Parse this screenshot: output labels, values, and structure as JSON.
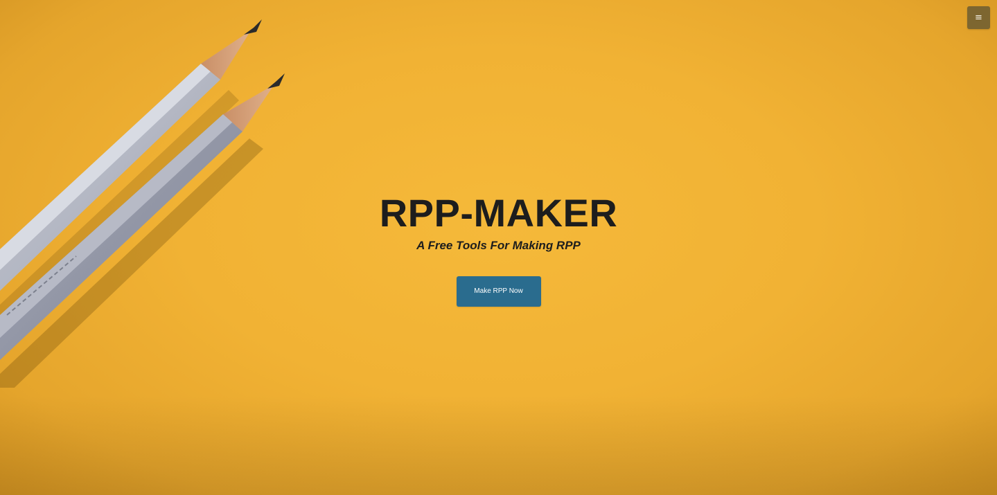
{
  "header": {
    "menu_icon": "hamburger-menu-icon",
    "menu_glyph": "≡"
  },
  "hero": {
    "title": "RPP-MAKER",
    "subtitle": "A Free Tools For Making RPP",
    "cta_label": "Make RPP Now",
    "background_image": "two-pencils-on-yellow-paper"
  },
  "colors": {
    "background": "#f1b234",
    "title_text": "#1d1d1d",
    "button": "#2a6c8e",
    "menu_button": "#7d6630"
  }
}
